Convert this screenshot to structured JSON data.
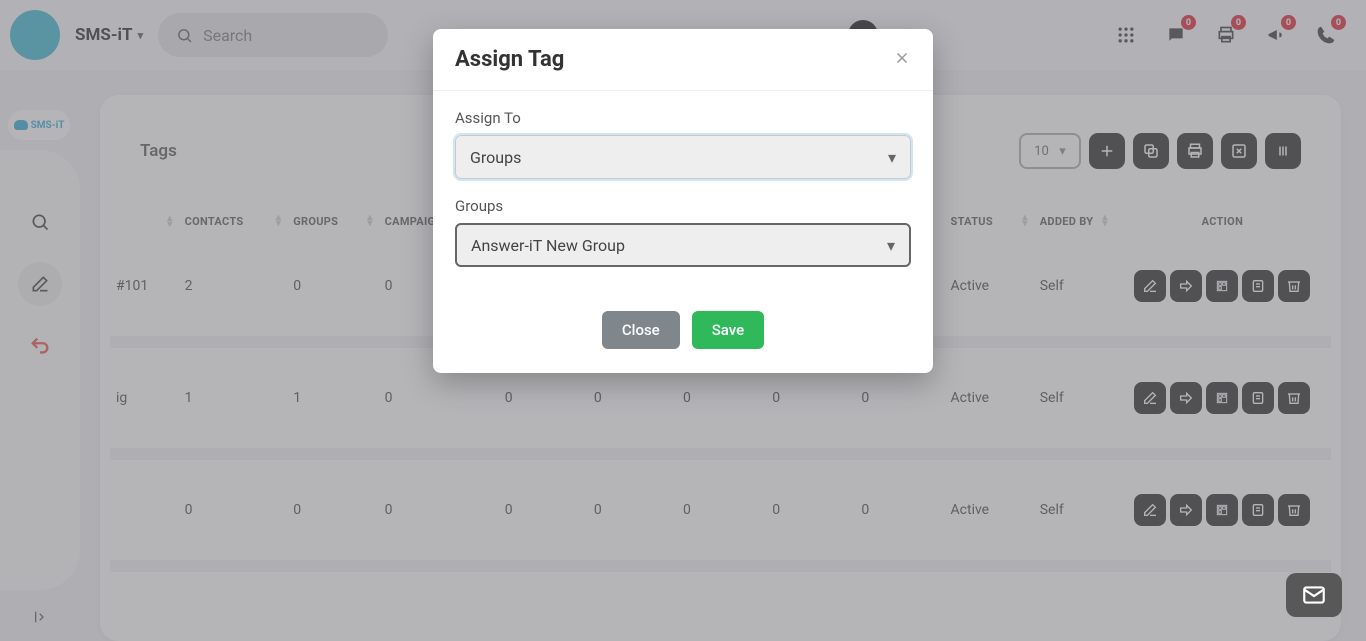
{
  "header": {
    "app_title": "SMS-iT",
    "search_placeholder": "Search",
    "badges": {
      "chat": "0",
      "print": "0",
      "announce": "0",
      "phone": "0"
    }
  },
  "sidebar_logo": "SMS-iT",
  "page": {
    "title": "Tags",
    "page_size": "10",
    "columns": {
      "name": "",
      "contacts": "CONTACTS",
      "groups": "GROUPS",
      "campaigns": "CAMPAIGNS",
      "status": "STATUS",
      "added_by": "ADDED BY",
      "action": "ACTION"
    },
    "rows": [
      {
        "name": "#101",
        "contacts": "2",
        "groups": "0",
        "campaigns": "0",
        "n1": "",
        "n2": "",
        "n3": "",
        "n4": "",
        "n5": "",
        "status": "Active",
        "added_by": "Self"
      },
      {
        "name": "ig",
        "contacts": "1",
        "groups": "1",
        "campaigns": "0",
        "n1": "0",
        "n2": "0",
        "n3": "0",
        "n4": "0",
        "n5": "0",
        "status": "Active",
        "added_by": "Self"
      },
      {
        "name": "",
        "contacts": "0",
        "groups": "0",
        "campaigns": "0",
        "n1": "0",
        "n2": "0",
        "n3": "0",
        "n4": "0",
        "n5": "0",
        "status": "Active",
        "added_by": "Self"
      }
    ]
  },
  "modal": {
    "title": "Assign Tag",
    "assign_to_label": "Assign To",
    "assign_to_value": "Groups",
    "groups_label": "Groups",
    "groups_value": "Answer-iT New Group",
    "close_btn": "Close",
    "save_btn": "Save"
  }
}
